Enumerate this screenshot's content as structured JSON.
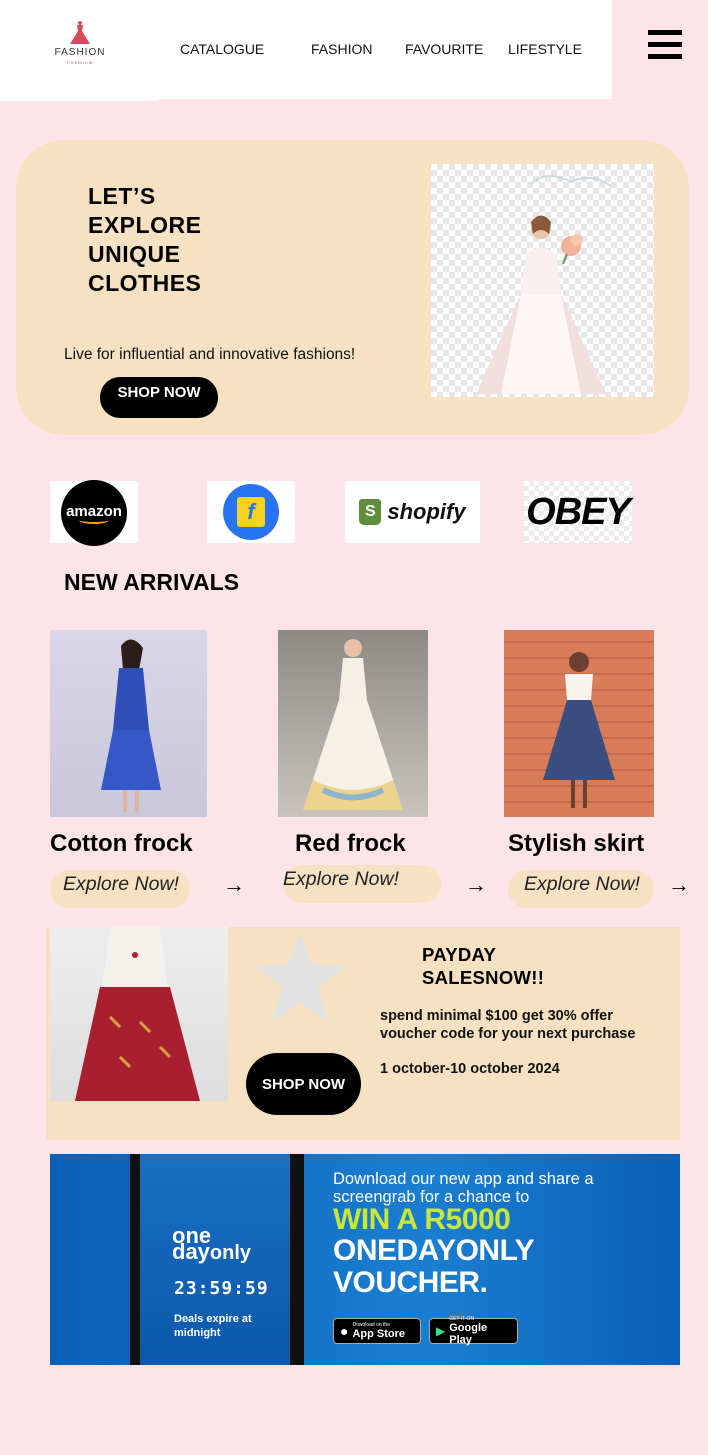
{
  "header": {
    "logo_text": "FASHION",
    "logo_sub": "PREMIUM",
    "nav": [
      "CATALOGUE",
      "FASHION",
      "FAVOURITE",
      "LIFESTYLE"
    ]
  },
  "hero": {
    "title_lines": [
      "LET’S",
      "EXPLORE",
      "UNIQUE",
      "CLOTHES"
    ],
    "tagline": "Live for influential and innovative fashions!",
    "button": "SHOP NOW"
  },
  "brands": {
    "amazon": "amazon",
    "flipkart": "f",
    "shopify": "shopify",
    "obey": "OBEY"
  },
  "arrivals": {
    "title": "NEW ARRIVALS",
    "products": [
      {
        "name": "Cotton frock",
        "cta": "Explore Now!"
      },
      {
        "name": "Red frock",
        "cta": "Explore Now!"
      },
      {
        "name": "Stylish skirt",
        "cta": "Explore Now!"
      }
    ],
    "arrow": "→"
  },
  "payday": {
    "title_lines": [
      "PAYDAY",
      "SALESNOW!!"
    ],
    "text": "spend minimal $100 get 30% offer voucher code for your next purchase",
    "date": "1 october-10 october 2024",
    "button": "SHOP NOW"
  },
  "banner": {
    "logo_top": "one",
    "logo_bottom_a": "day",
    "logo_bottom_b": "only",
    "timer": "23:59:59",
    "expire": "Deals expire at midnight",
    "line1": "Download our new app and share a screengrab for a chance to",
    "line2": "WIN A R5000",
    "line3a": "ONEDAYONLY",
    "line3b": "VOUCHER.",
    "appstore_small": "Download on the",
    "appstore": "App Store",
    "googleplay_small": "GET IT ON",
    "googleplay": "Google Play"
  },
  "colors": {
    "background": "#fde4e8",
    "beige": "#f6e2c2",
    "button": "#000000",
    "banner_blue": "#1a7fd1",
    "banner_green": "#c8e63c"
  }
}
